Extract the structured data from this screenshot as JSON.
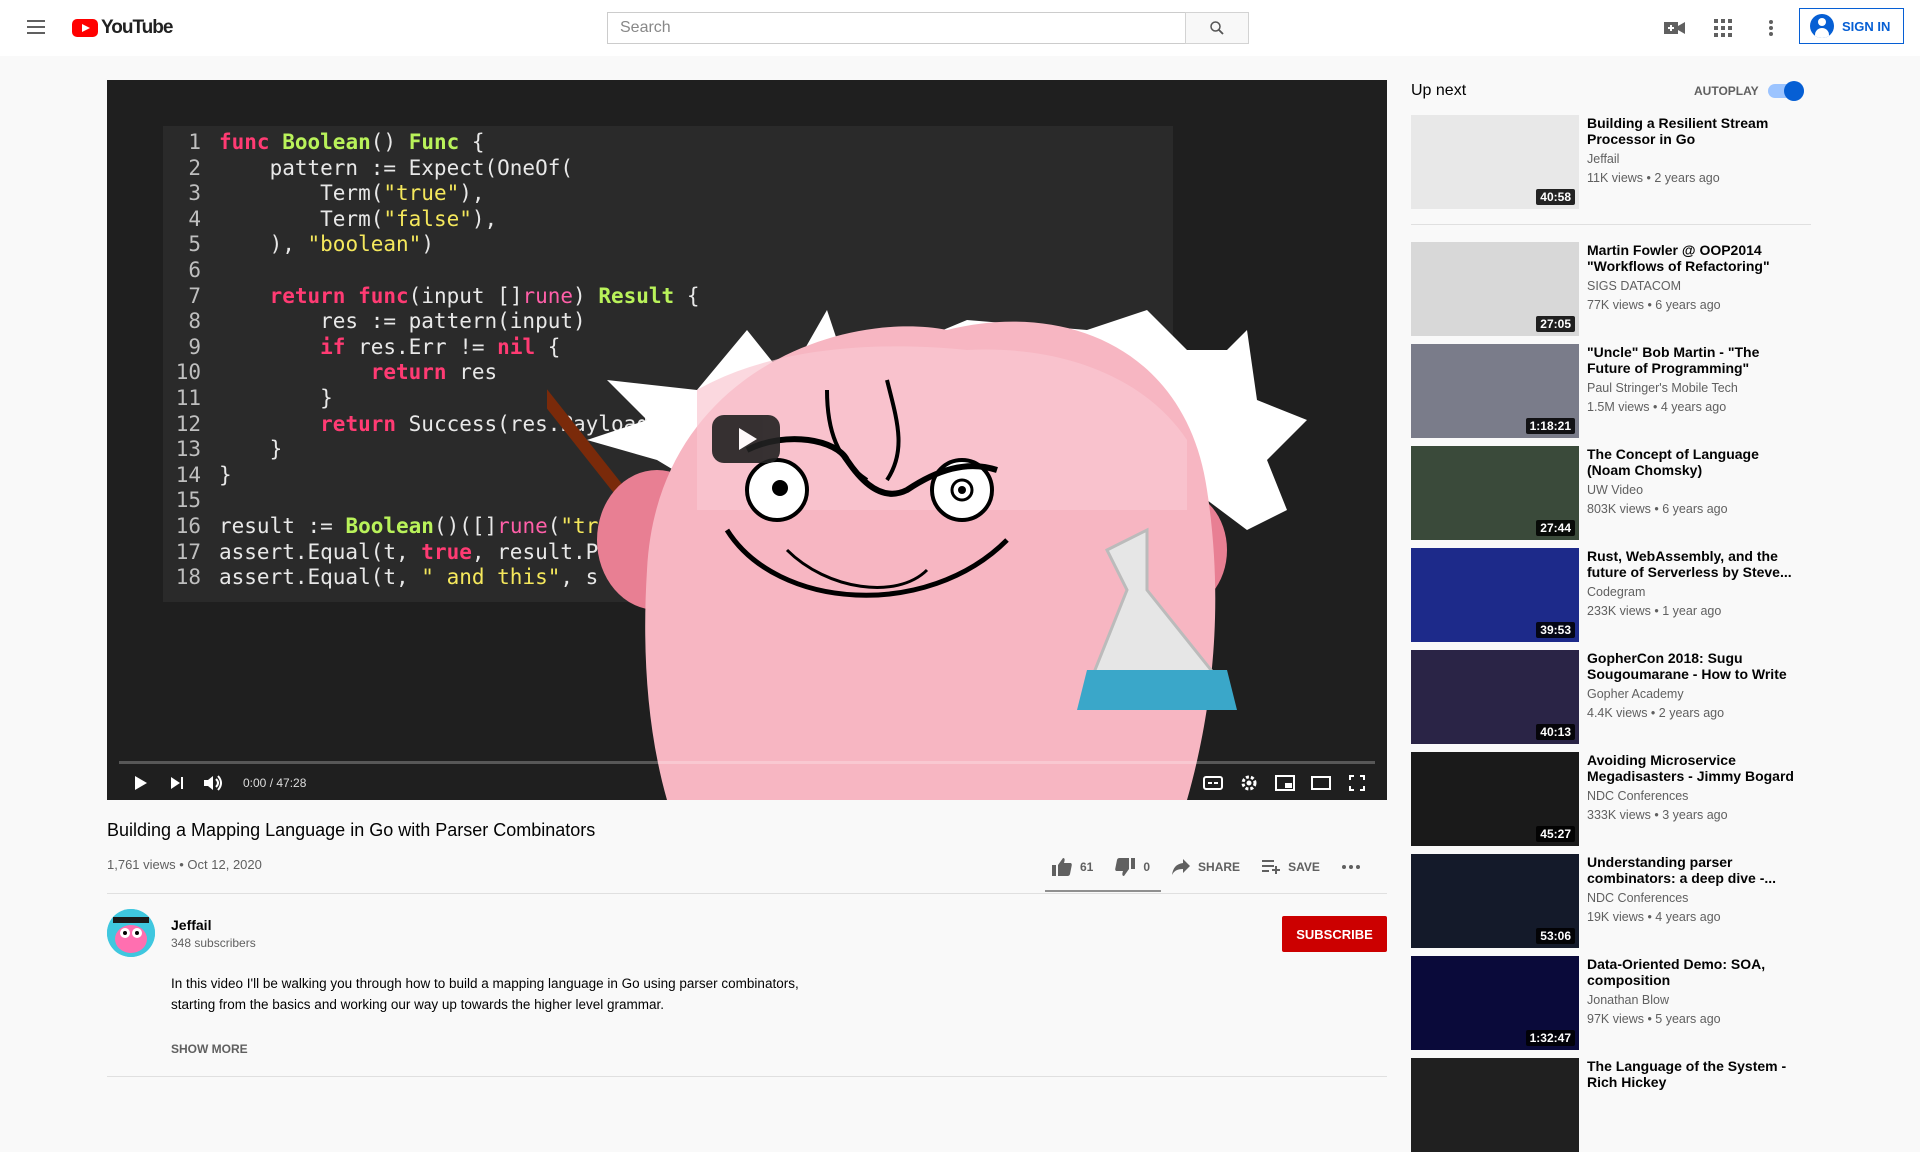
{
  "header": {
    "logo_text": "YouTube",
    "search_placeholder": "Search",
    "signin_label": "SIGN IN"
  },
  "player": {
    "code_lines": [
      [
        "1",
        "func Boolean() Func {"
      ],
      [
        "2",
        "    pattern := Expect(OneOf("
      ],
      [
        "3",
        "        Term(\"true\"),"
      ],
      [
        "4",
        "        Term(\"false\"),"
      ],
      [
        "5",
        "    ), \"boolean\")"
      ],
      [
        "6",
        ""
      ],
      [
        "7",
        "    return func(input []rune) Result {"
      ],
      [
        "8",
        "        res := pattern(input)"
      ],
      [
        "9",
        "        if res.Err != nil {"
      ],
      [
        "10",
        "            return res"
      ],
      [
        "11",
        "        }"
      ],
      [
        "12",
        "        return Success(res.Payload.("
      ],
      [
        "13",
        "    }"
      ],
      [
        "14",
        "}"
      ],
      [
        "15",
        ""
      ],
      [
        "16",
        "result := Boolean()([]rune(\"true and"
      ],
      [
        "17",
        "assert.Equal(t, true, result.Payl"
      ],
      [
        "18",
        "assert.Equal(t, \" and this\", s"
      ]
    ],
    "time_display": "0:00 / 47:28",
    "progress_fraction": 0.0
  },
  "video": {
    "title": "Building a Mapping Language in Go with Parser Combinators",
    "meta": "1,761 views • Oct 12, 2020",
    "likes": "61",
    "dislikes": "0",
    "share_label": "SHARE",
    "save_label": "SAVE"
  },
  "channel": {
    "name": "Jeffail",
    "subscribers": "348 subscribers",
    "subscribe_label": "SUBSCRIBE"
  },
  "description": {
    "text": "In this video I'll be walking you through how to build a mapping language in Go using parser combinators, starting from the basics and working our way up towards the higher level grammar.",
    "show_more": "SHOW MORE"
  },
  "sidebar": {
    "up_next": "Up next",
    "autoplay": "AUTOPLAY",
    "autoplay_on": true,
    "items": [
      {
        "title": "Building a Resilient Stream Processor in Go",
        "channel": "Jeffail",
        "views": "11K views • 2 years ago",
        "duration": "40:58",
        "thumb": "#e8e8e8"
      },
      {
        "title": "Martin Fowler @ OOP2014 \"Workflows of Refactoring\"",
        "channel": "SIGS DATACOM",
        "views": "77K views • 6 years ago",
        "duration": "27:05",
        "thumb": "#d8d8d8"
      },
      {
        "title": "\"Uncle\" Bob Martin - \"The Future of Programming\"",
        "channel": "Paul Stringer's Mobile Tech",
        "views": "1.5M views • 4 years ago",
        "duration": "1:18:21",
        "thumb": "#7a7c8a"
      },
      {
        "title": "The Concept of Language (Noam Chomsky)",
        "channel": "UW Video",
        "views": "803K views • 6 years ago",
        "duration": "27:44",
        "thumb": "#3a4a3a"
      },
      {
        "title": "Rust, WebAssembly, and the future of Serverless by Steve...",
        "channel": "Codegram",
        "views": "233K views • 1 year ago",
        "duration": "39:53",
        "thumb": "#1d2a8a"
      },
      {
        "title": "GopherCon 2018: Sugu Sougoumarane - How to Write ...",
        "channel": "Gopher Academy",
        "views": "4.4K views • 2 years ago",
        "duration": "40:13",
        "thumb": "#2a2446"
      },
      {
        "title": "Avoiding Microservice Megadisasters - Jimmy Bogard",
        "channel": "NDC Conferences",
        "views": "333K views • 3 years ago",
        "duration": "45:27",
        "thumb": "#1a1a1a"
      },
      {
        "title": "Understanding parser combinators: a deep dive -...",
        "channel": "NDC Conferences",
        "views": "19K views • 4 years ago",
        "duration": "53:06",
        "thumb": "#141a2a"
      },
      {
        "title": "Data-Oriented Demo: SOA, composition",
        "channel": "Jonathan Blow",
        "views": "97K views • 5 years ago",
        "duration": "1:32:47",
        "thumb": "#0a0a3a"
      },
      {
        "title": "The Language of the System - Rich Hickey",
        "channel": "",
        "views": "",
        "duration": "",
        "thumb": "#202020"
      }
    ]
  },
  "colors": {
    "accent_red": "#ff0000",
    "subscribe_red": "#cc0000",
    "link_blue": "#065fd4"
  }
}
